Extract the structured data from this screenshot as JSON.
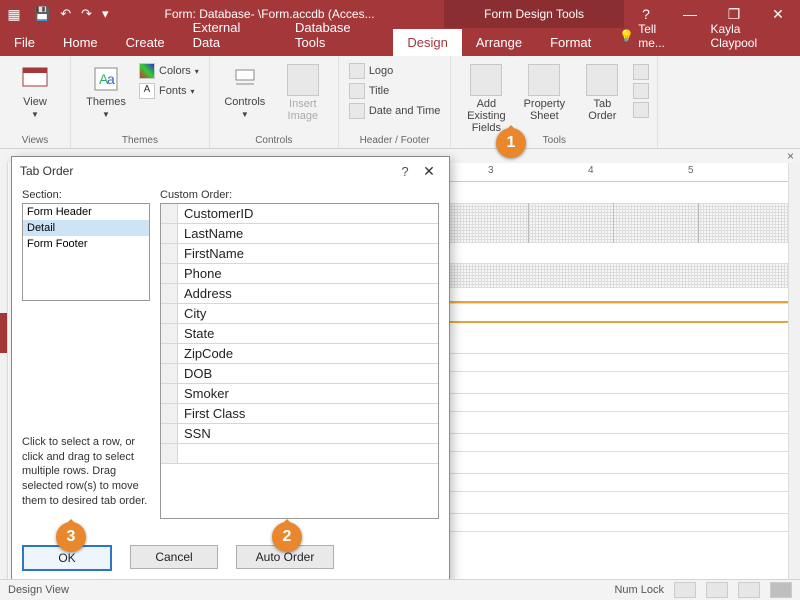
{
  "title": "Form: Database- \\Form.accdb (Acces...",
  "tools_context": "Form Design Tools",
  "user": "Kayla Claypool",
  "tell_me": "Tell me...",
  "tabs": [
    "File",
    "Home",
    "Create",
    "External Data",
    "Database Tools",
    "Design",
    "Arrange",
    "Format"
  ],
  "active_tab": 5,
  "ribbon": {
    "views": {
      "label": "Views",
      "btn": "View"
    },
    "themes": {
      "label": "Themes",
      "btn": "Themes",
      "colors": "Colors",
      "fonts": "Fonts"
    },
    "controls": {
      "label": "Controls",
      "btn": "Controls",
      "insert": "Insert\nImage"
    },
    "header": {
      "label": "Header / Footer",
      "logo": "Logo",
      "title": "Title",
      "date": "Date and Time"
    },
    "tools": {
      "label": "Tools",
      "addf": "Add Existing\nFields",
      "prop": "Property\nSheet",
      "tab": "Tab\nOrder"
    }
  },
  "ruler_nums": [
    "3",
    "4",
    "5"
  ],
  "dialog": {
    "title": "Tab Order",
    "section_label": "Section:",
    "sections": [
      "Form Header",
      "Detail",
      "Form Footer"
    ],
    "sections_sel": 1,
    "custom_label": "Custom Order:",
    "order": [
      "CustomerID",
      "LastName",
      "FirstName",
      "Phone",
      "Address",
      "City",
      "State",
      "ZipCode",
      "DOB",
      "Smoker",
      "First Class",
      "SSN"
    ],
    "hint": "Click to select a row, or click and drag to select multiple rows.  Drag selected row(s) to move them to desired tab order.",
    "ok": "OK",
    "cancel": "Cancel",
    "auto": "Auto Order"
  },
  "status": {
    "left": "Design View",
    "numlock": "Num Lock"
  },
  "callouts": {
    "1": "1",
    "2": "2",
    "3": "3"
  }
}
